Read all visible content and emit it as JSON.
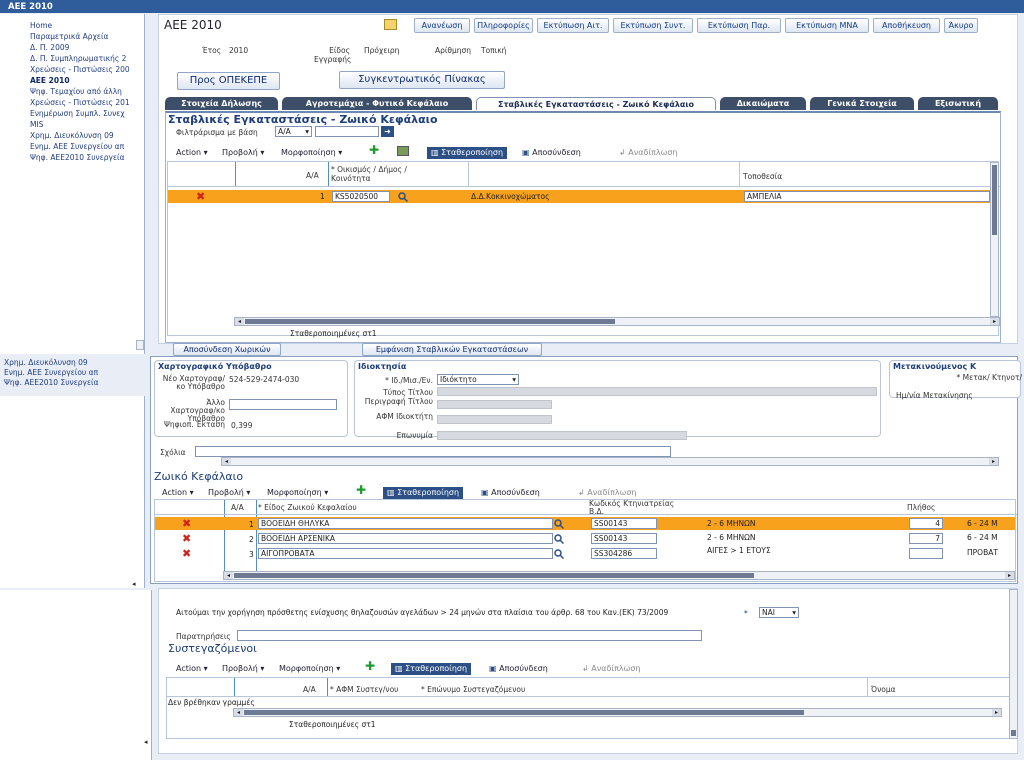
{
  "titlebar": {
    "text": "ΑΕΕ 2010"
  },
  "nav": {
    "items": [
      {
        "label": "Home"
      },
      {
        "label": "Παραμετρικά Αρχεία"
      },
      {
        "label": "Δ. Π. 2009"
      },
      {
        "label": "Δ. Π. Συμπληρωματικής 2"
      },
      {
        "label": "Χρεώσεις - Πιστώσεις 200"
      },
      {
        "label": "ΑΕΕ 2010"
      },
      {
        "label": "Ψηφ. Τεμαχίου από άλλη"
      },
      {
        "label": "Χρεώσεις - Πιστώσεις 201"
      },
      {
        "label": "Ενημέρωση Συμπλ. Συνεχ"
      },
      {
        "label": "MIS"
      },
      {
        "label": "Χρημ. Διευκόλυνση 09"
      },
      {
        "label": "Ενημ. ΑΕΕ Συνεργείου απ"
      },
      {
        "label": "Ψηφ. ΑΕΕ2010 Συνεργεία"
      }
    ],
    "dup_items": [
      {
        "label": "Χρημ. Διευκόλυνση 09"
      },
      {
        "label": "Ενημ. ΑΕΕ Συνεργείου απ"
      },
      {
        "label": "Ψηφ. ΑΕΕ2010 Συνεργεία"
      }
    ]
  },
  "header": {
    "title": "ΑΕΕ 2010",
    "buttons": [
      "Ανανέωση",
      "Πληροφορίες",
      "Εκτύπωση Αιτ.",
      "Εκτύπωση Συντ.",
      "Εκτύπωση Παρ.",
      "Εκτύπωση ΜΝΑ",
      "Αποθήκευση",
      "Άκυρο"
    ]
  },
  "meta": {
    "year_label": "Έτος",
    "year_value": "2010",
    "type_label": "Είδος Εγγραφής",
    "type_value": "Πρόχειρη",
    "numbering_label": "Αρίθμηση",
    "numbering_value": "Τοπική"
  },
  "actions": {
    "opekepe": "Προς ΟΠΕΚΕΠΕ",
    "summary": "Συγκεντρωτικός Πίνακας"
  },
  "tabs": [
    {
      "label": "Στοιχεία Δήλωσης"
    },
    {
      "label": "Αγροτεμάχια - Φυτικό Κεφάλαιο"
    },
    {
      "label": "Σταβλικές Εγκαταστάσεις - Ζωικό Κεφάλαιο"
    },
    {
      "label": "Δικαιώματα"
    },
    {
      "label": "Γενικά Στοιχεία"
    },
    {
      "label": "Εξισωτική"
    }
  ],
  "stables": {
    "title": "Σταβλικές Εγκαταστάσεις - Ζωικό Κεφάλαιο",
    "filter_label": "Φιλτράρισμα με βάση",
    "filter_value": "Α/Α",
    "toolbar": {
      "action": "Action",
      "view": "Προβολή",
      "format": "Μορφοποίηση",
      "freeze": "Σταθεροποίηση",
      "detach": "Αποσύνδεση",
      "wrap": "Αναδίπλωση"
    },
    "columns": {
      "aa": "Α/Α",
      "settlement": "* Οικισμός / Δήμος / Κοινότητα",
      "location": "Τοποθεσία"
    },
    "rows": [
      {
        "aa": "1",
        "code": "KS5020500",
        "name": "Δ.Δ.Κοκκινοχώματος",
        "location": "ΑΜΠΕΛΙΑ"
      }
    ],
    "frozen": "Σταθεροποιημένες στ1",
    "btn_detach_lands": "Αποσύνδεση Χωρικών",
    "btn_show_stables": "Εμφάνιση Σταβλικών Εγκαταστάσεων"
  },
  "carto": {
    "title": "Χαρτογραφικό Υπόβαθρο",
    "new_label": "Νέο Χαρτογραφ/κο Υπόβαθρο",
    "new_value": "524-529-2474-030",
    "other_label": "Άλλο Χαρτογραφ/κο Υπόβαθρο",
    "area_label": "Ψηφιοπ. Έκταση",
    "area_value": "0,399"
  },
  "owner": {
    "title": "Ιδιοκτησία",
    "status_label": "* Ιδ./Μισ./Εν.",
    "status_value": "Ιδιόκτητο",
    "deed_label": "Τύπος Τίτλου",
    "desc_label": "Περιγραφή Τίτλου",
    "afm_label": "ΑΦΜ Ιδιοκτήτη",
    "name_label": "Επωνυμία"
  },
  "movement": {
    "title": "Μετακινούμενος Κ",
    "label1": "* Μετακ/ Κτηνοτ/",
    "label2": "Ημ/νία Μετακίνησης"
  },
  "comments_label": "Σχόλια",
  "livestock": {
    "title": "Ζωικό Κεφάλαιο",
    "columns": {
      "aa": "Α/Α",
      "kind": "* Είδος Ζωικού Κεφαλαίου",
      "code": "Κωδικός Κτηνιατρείας Β.Δ.",
      "count": "Πλήθος"
    },
    "rows": [
      {
        "aa": "1",
        "kind": "ΒΟΟΕΙΔΗ ΘΗΛΥΚΑ",
        "code": "SS00143",
        "age": "2 - 6 ΜΗΝΩΝ",
        "count": "4",
        "extra": "6 - 24 Μ"
      },
      {
        "aa": "2",
        "kind": "ΒΟΟΕΙΔΗ ΑΡΣΕΝΙΚΑ",
        "code": "SS00143",
        "age": "2 - 6 ΜΗΝΩΝ",
        "count": "7",
        "extra": "6 - 24 Μ"
      },
      {
        "aa": "3",
        "kind": "ΑΙΓΟΠΡΟΒΑΤΑ",
        "code": "SS304286",
        "age": "ΑΙΓΕΣ > 1 ΕΤΟΥΣ",
        "count": "",
        "extra": "ΠΡΟΒΑΤ"
      }
    ]
  },
  "request": {
    "text": "Αιτούμαι την χορήγηση πρόσθετης ενίσχυσης θηλαζουσών αγελάδων > 24 μηνών στα πλαίσια του άρθρ. 68 του Καν.(ΕΚ) 73/2009",
    "value": "ΝΑΙ"
  },
  "remarks_label": "Παρατηρήσεις",
  "partners": {
    "title": "Συστεγαζόμενοι",
    "columns": {
      "aa": "Α/Α",
      "afm": "* ΑΦΜ Συστεγ/νου",
      "name": "* Επώνυμο Συστεγαζόμενου",
      "first": "Όνομα"
    },
    "empty": "Δεν βρέθηκαν γραμμές",
    "frozen": "Σταθεροποιημένες στ1"
  }
}
